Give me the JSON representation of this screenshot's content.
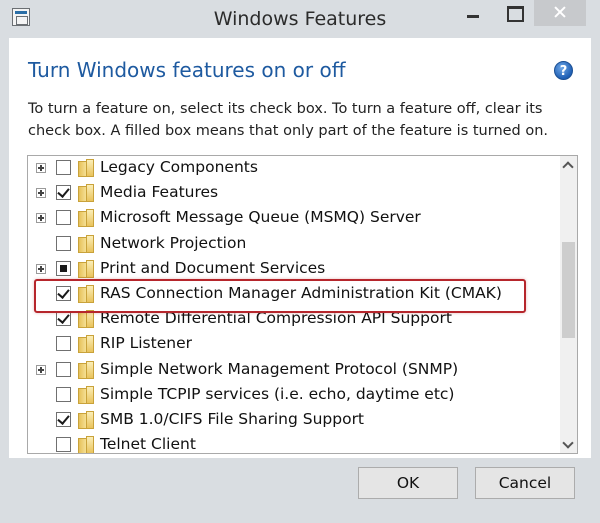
{
  "window": {
    "title": "Windows Features"
  },
  "header": {
    "heading": "Turn Windows features on or off",
    "description": "To turn a feature on, select its check box. To turn a feature off, clear its check box. A filled box means that only part of the feature is turned on.",
    "help_symbol": "?"
  },
  "features": [
    {
      "label": "Legacy Components",
      "state": "unchecked",
      "expandable": true
    },
    {
      "label": "Media Features",
      "state": "checked",
      "expandable": true
    },
    {
      "label": "Microsoft Message Queue (MSMQ) Server",
      "state": "unchecked",
      "expandable": true
    },
    {
      "label": "Network Projection",
      "state": "unchecked",
      "expandable": false
    },
    {
      "label": "Print and Document Services",
      "state": "partial",
      "expandable": true
    },
    {
      "label": "RAS Connection Manager Administration Kit (CMAK)",
      "state": "checked",
      "expandable": false
    },
    {
      "label": "Remote Differential Compression API Support",
      "state": "checked",
      "expandable": false
    },
    {
      "label": "RIP Listener",
      "state": "unchecked",
      "expandable": false
    },
    {
      "label": "Simple Network Management Protocol (SNMP)",
      "state": "unchecked",
      "expandable": true
    },
    {
      "label": "Simple TCPIP services (i.e. echo, daytime etc)",
      "state": "unchecked",
      "expandable": false
    },
    {
      "label": "SMB 1.0/CIFS File Sharing Support",
      "state": "checked",
      "expandable": false
    },
    {
      "label": "Telnet Client",
      "state": "unchecked",
      "expandable": false
    }
  ],
  "buttons": {
    "ok": "OK",
    "cancel": "Cancel"
  },
  "colors": {
    "heading": "#1e5aa0",
    "highlight": "#b6262c"
  }
}
